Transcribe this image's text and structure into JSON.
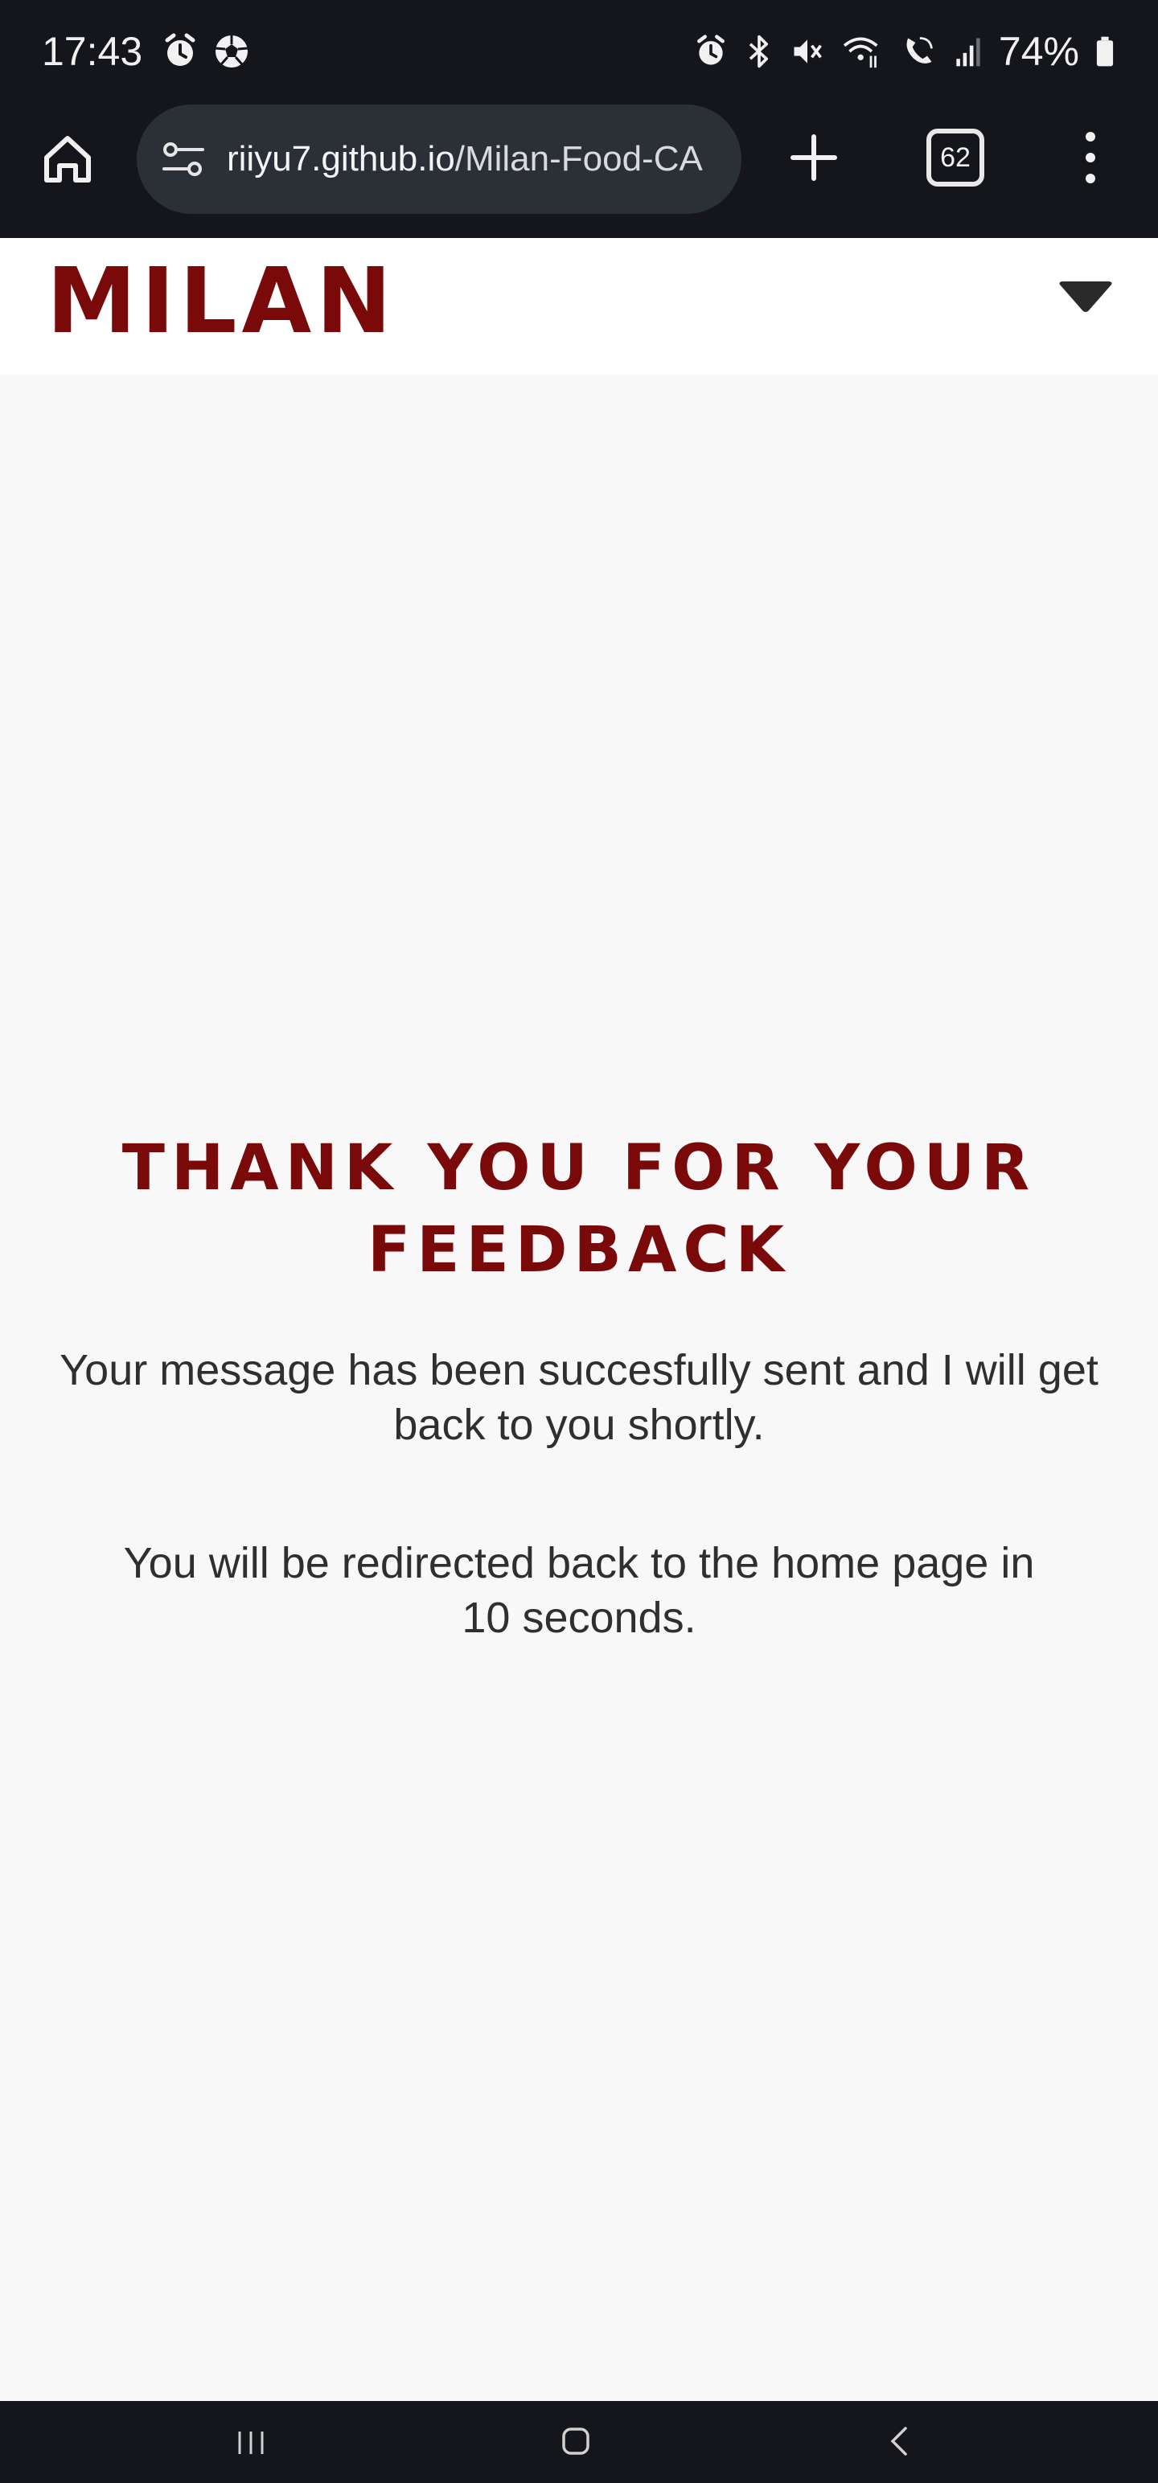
{
  "status_bar": {
    "time": "17:43",
    "battery": "74%",
    "left_icons": [
      "alarm-icon",
      "soccer-ball-icon"
    ],
    "right_icons": [
      "alarm-icon",
      "bluetooth-icon",
      "mute-icon",
      "wifi-calling-icon",
      "wifi-call-icon",
      "signal-icon",
      "battery-icon"
    ]
  },
  "browser": {
    "url_domain": "riiyu7.github.io",
    "url_path": "/Milan-Food-CA",
    "tab_count": "62"
  },
  "header": {
    "logo": "MILAN"
  },
  "main": {
    "title": "THANK YOU FOR YOUR FEEDBACK",
    "message": "Your message has been succesfully sent and I will get back to you shortly.",
    "redirect_notice": "You will be redirected back to the home page in 10 seconds."
  },
  "colors": {
    "brand": "#7a0a0a",
    "system_bar": "#14161b",
    "page_bg": "#f8f8f8"
  }
}
